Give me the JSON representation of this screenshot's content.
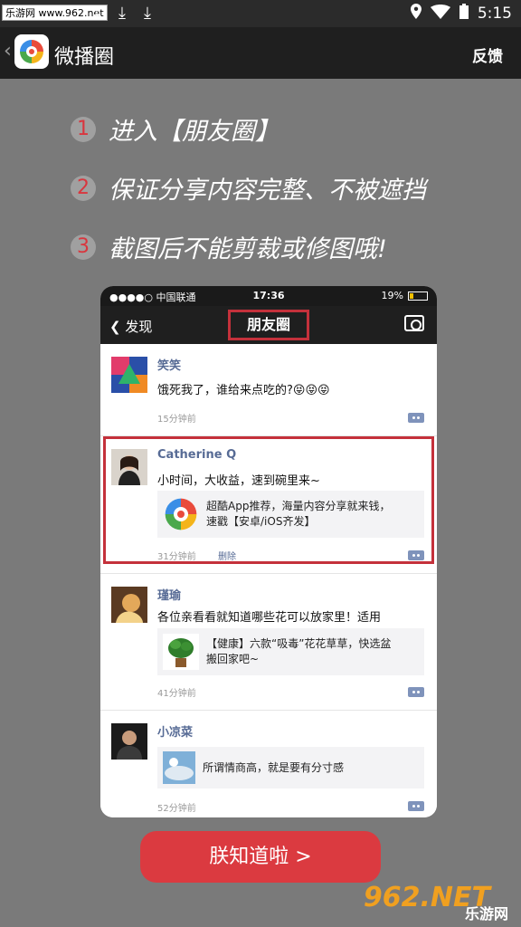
{
  "statusbar": {
    "watermark": "乐游网 www.962.net",
    "time": "5:15"
  },
  "appbar": {
    "title": "微播圈",
    "feedback": "反馈"
  },
  "steps": [
    {
      "num": "1",
      "text": "进入【朋友圈】"
    },
    {
      "num": "2",
      "text": "保证分享内容完整、不被遮挡"
    },
    {
      "num": "3",
      "text": "截图后不能剪裁或修图哦!"
    }
  ],
  "phone": {
    "status": {
      "carrier": "●●●●○ 中国联通",
      "time": "17:36",
      "battery": "19%"
    },
    "nav": {
      "back": "❮ 发现",
      "title": "朋友圈"
    },
    "posts": [
      {
        "name": "笑笑",
        "text": "饿死我了，谁给来点吃的?😝😝😝",
        "time": "15分钟前"
      },
      {
        "name": "Catherine Q",
        "text": "小时间，大收益，速到碗里来~",
        "card_line1": "超酷App推荐，海量内容分享就来钱，",
        "card_line2": "速戳【安卓/iOS齐发】",
        "time": "31分钟前",
        "delete": "删除"
      },
      {
        "name": "瑾瑜",
        "text": "各位亲看看就知道哪些花可以放家里！适用",
        "card_line1": "【健康】六款“吸毒”花花草草，快选盆",
        "card_line2": "搬回家吧~",
        "time": "41分钟前"
      },
      {
        "name": "小凉菜",
        "card_line1": "所谓情商高，就是要有分寸感",
        "time": "52分钟前"
      }
    ]
  },
  "cta": {
    "label": "朕知道啦 >"
  },
  "watermark": {
    "num": "962.NET",
    "sub": "乐游网"
  },
  "colors": {
    "accent": "#db3a40",
    "link": "#576b95"
  }
}
